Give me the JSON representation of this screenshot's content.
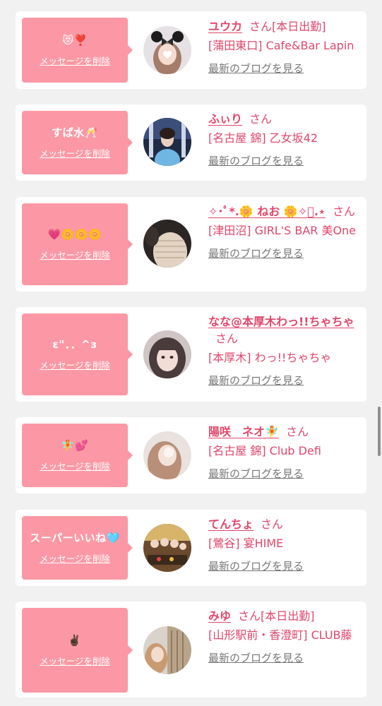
{
  "common": {
    "delete_label": "メッセージを削除",
    "san": "さん",
    "blog_label": "最新のブログを見る"
  },
  "colors": {
    "page_bg": "#f1f1f1",
    "bubble_bg": "#fc98a5",
    "name_color": "#e0476b",
    "blog_color": "#777777"
  },
  "items": [
    {
      "message": "😻❣️",
      "name": "ユウカ",
      "status": "[本日出勤]",
      "shop": "[蒲田東口] Cafe&Bar Lapin",
      "avatar": "avatar-girl-bear-ears"
    },
    {
      "message": "すぱ水🥂",
      "name": "ふぃり",
      "status": "",
      "shop": "[名古屋 錦] 乙女坂42",
      "avatar": "avatar-girl-blue-dress"
    },
    {
      "message": "💗🌼🌼🌼",
      "name": "✧･ﾟ*.🌼 ねお 🌼✧ﾟ.⋆",
      "status": "",
      "shop": "[津田沼] GIRL'S BAR 美One",
      "avatar": "avatar-girl-knit"
    },
    {
      "message": "ε\"．．^з",
      "name": "なな@本厚木わっ!!ちゃちゃ",
      "status": "",
      "shop": "[本厚木] わっ!!ちゃちゃ",
      "avatar": "avatar-girl-selfie"
    },
    {
      "message": "🧚💕",
      "name": "陽咲　ネオ🧚",
      "status": "",
      "shop": "[名古屋 錦] Club Defi",
      "avatar": "avatar-girl-long-hair"
    },
    {
      "message": "スーパーいいね🩵",
      "name": "てんちょ",
      "status": "",
      "shop": "[鶯谷] 宴HIME",
      "avatar": "avatar-group-photo"
    },
    {
      "message": "✌🏿",
      "name": "みゆ",
      "status": "[本日出勤]",
      "shop": "[山形駅前・香澄町] CLUB藤",
      "avatar": "avatar-girl-building"
    }
  ]
}
